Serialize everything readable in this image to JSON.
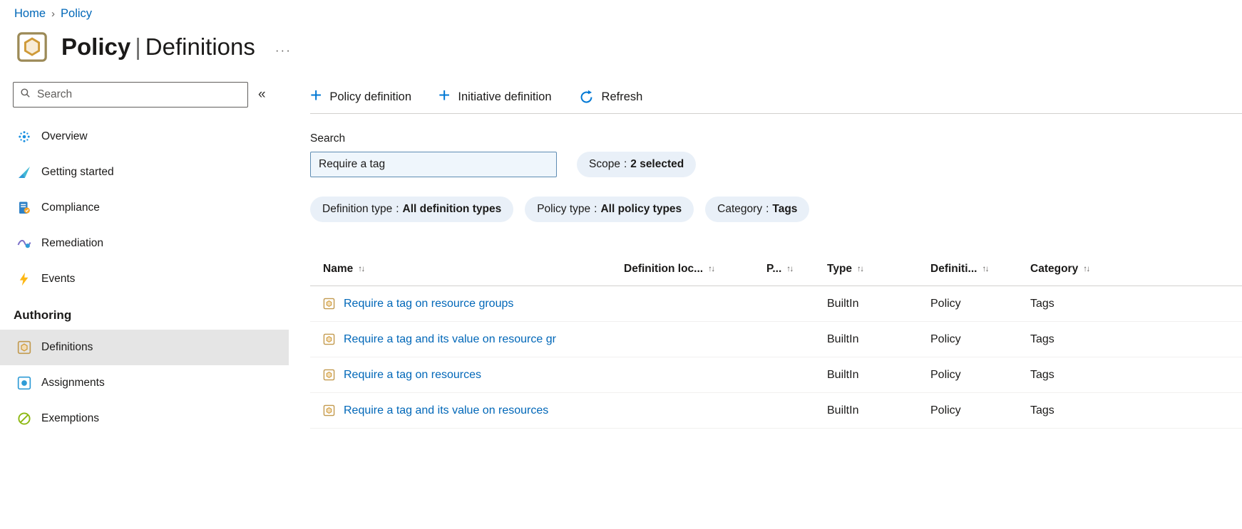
{
  "breadcrumb": {
    "home": "Home",
    "policy": "Policy",
    "separator": "›"
  },
  "header": {
    "title": "Policy",
    "separator": "|",
    "subtitle": "Definitions",
    "more": "···"
  },
  "icons": {
    "collapse": "«",
    "plus": "+",
    "sort": "↑↓"
  },
  "sidebar": {
    "search_placeholder": "Search",
    "items": [
      {
        "label": "Overview"
      },
      {
        "label": "Getting started"
      },
      {
        "label": "Compliance"
      },
      {
        "label": "Remediation"
      },
      {
        "label": "Events"
      }
    ],
    "section": "Authoring",
    "authoring": [
      {
        "label": "Definitions",
        "selected": true
      },
      {
        "label": "Assignments",
        "selected": false
      },
      {
        "label": "Exemptions",
        "selected": false
      }
    ]
  },
  "toolbar": {
    "policy_definition": "Policy definition",
    "initiative_definition": "Initiative definition",
    "refresh": "Refresh"
  },
  "filters": {
    "search_label": "Search",
    "search_value": "Require a tag",
    "separator": ":",
    "scope": {
      "name": "Scope",
      "value": "2 selected"
    },
    "definition_type": {
      "name": "Definition type",
      "value": "All definition types"
    },
    "policy_type": {
      "name": "Policy type",
      "value": "All policy types"
    },
    "category": {
      "name": "Category",
      "value": "Tags"
    }
  },
  "table": {
    "columns": [
      "Name",
      "Definition loc...",
      "P...",
      "Type",
      "Definiti...",
      "Category"
    ],
    "rows": [
      {
        "name": "Require a tag on resource groups",
        "definition_location": "",
        "type": "BuiltIn",
        "definition_type": "Policy",
        "category": "Tags"
      },
      {
        "name": "Require a tag and its value on resource gr",
        "definition_location": "",
        "type": "BuiltIn",
        "definition_type": "Policy",
        "category": "Tags"
      },
      {
        "name": "Require a tag on resources",
        "definition_location": "",
        "type": "BuiltIn",
        "definition_type": "Policy",
        "category": "Tags"
      },
      {
        "name": "Require a tag and its value on resources",
        "definition_location": "",
        "type": "BuiltIn",
        "definition_type": "Policy",
        "category": "Tags"
      }
    ]
  },
  "colors": {
    "link": "#0067b8",
    "accent": "#0078d4",
    "pill_bg": "#e9f0f8",
    "selected_bg": "#e5e5e5",
    "search_bg": "#eff6fc"
  }
}
